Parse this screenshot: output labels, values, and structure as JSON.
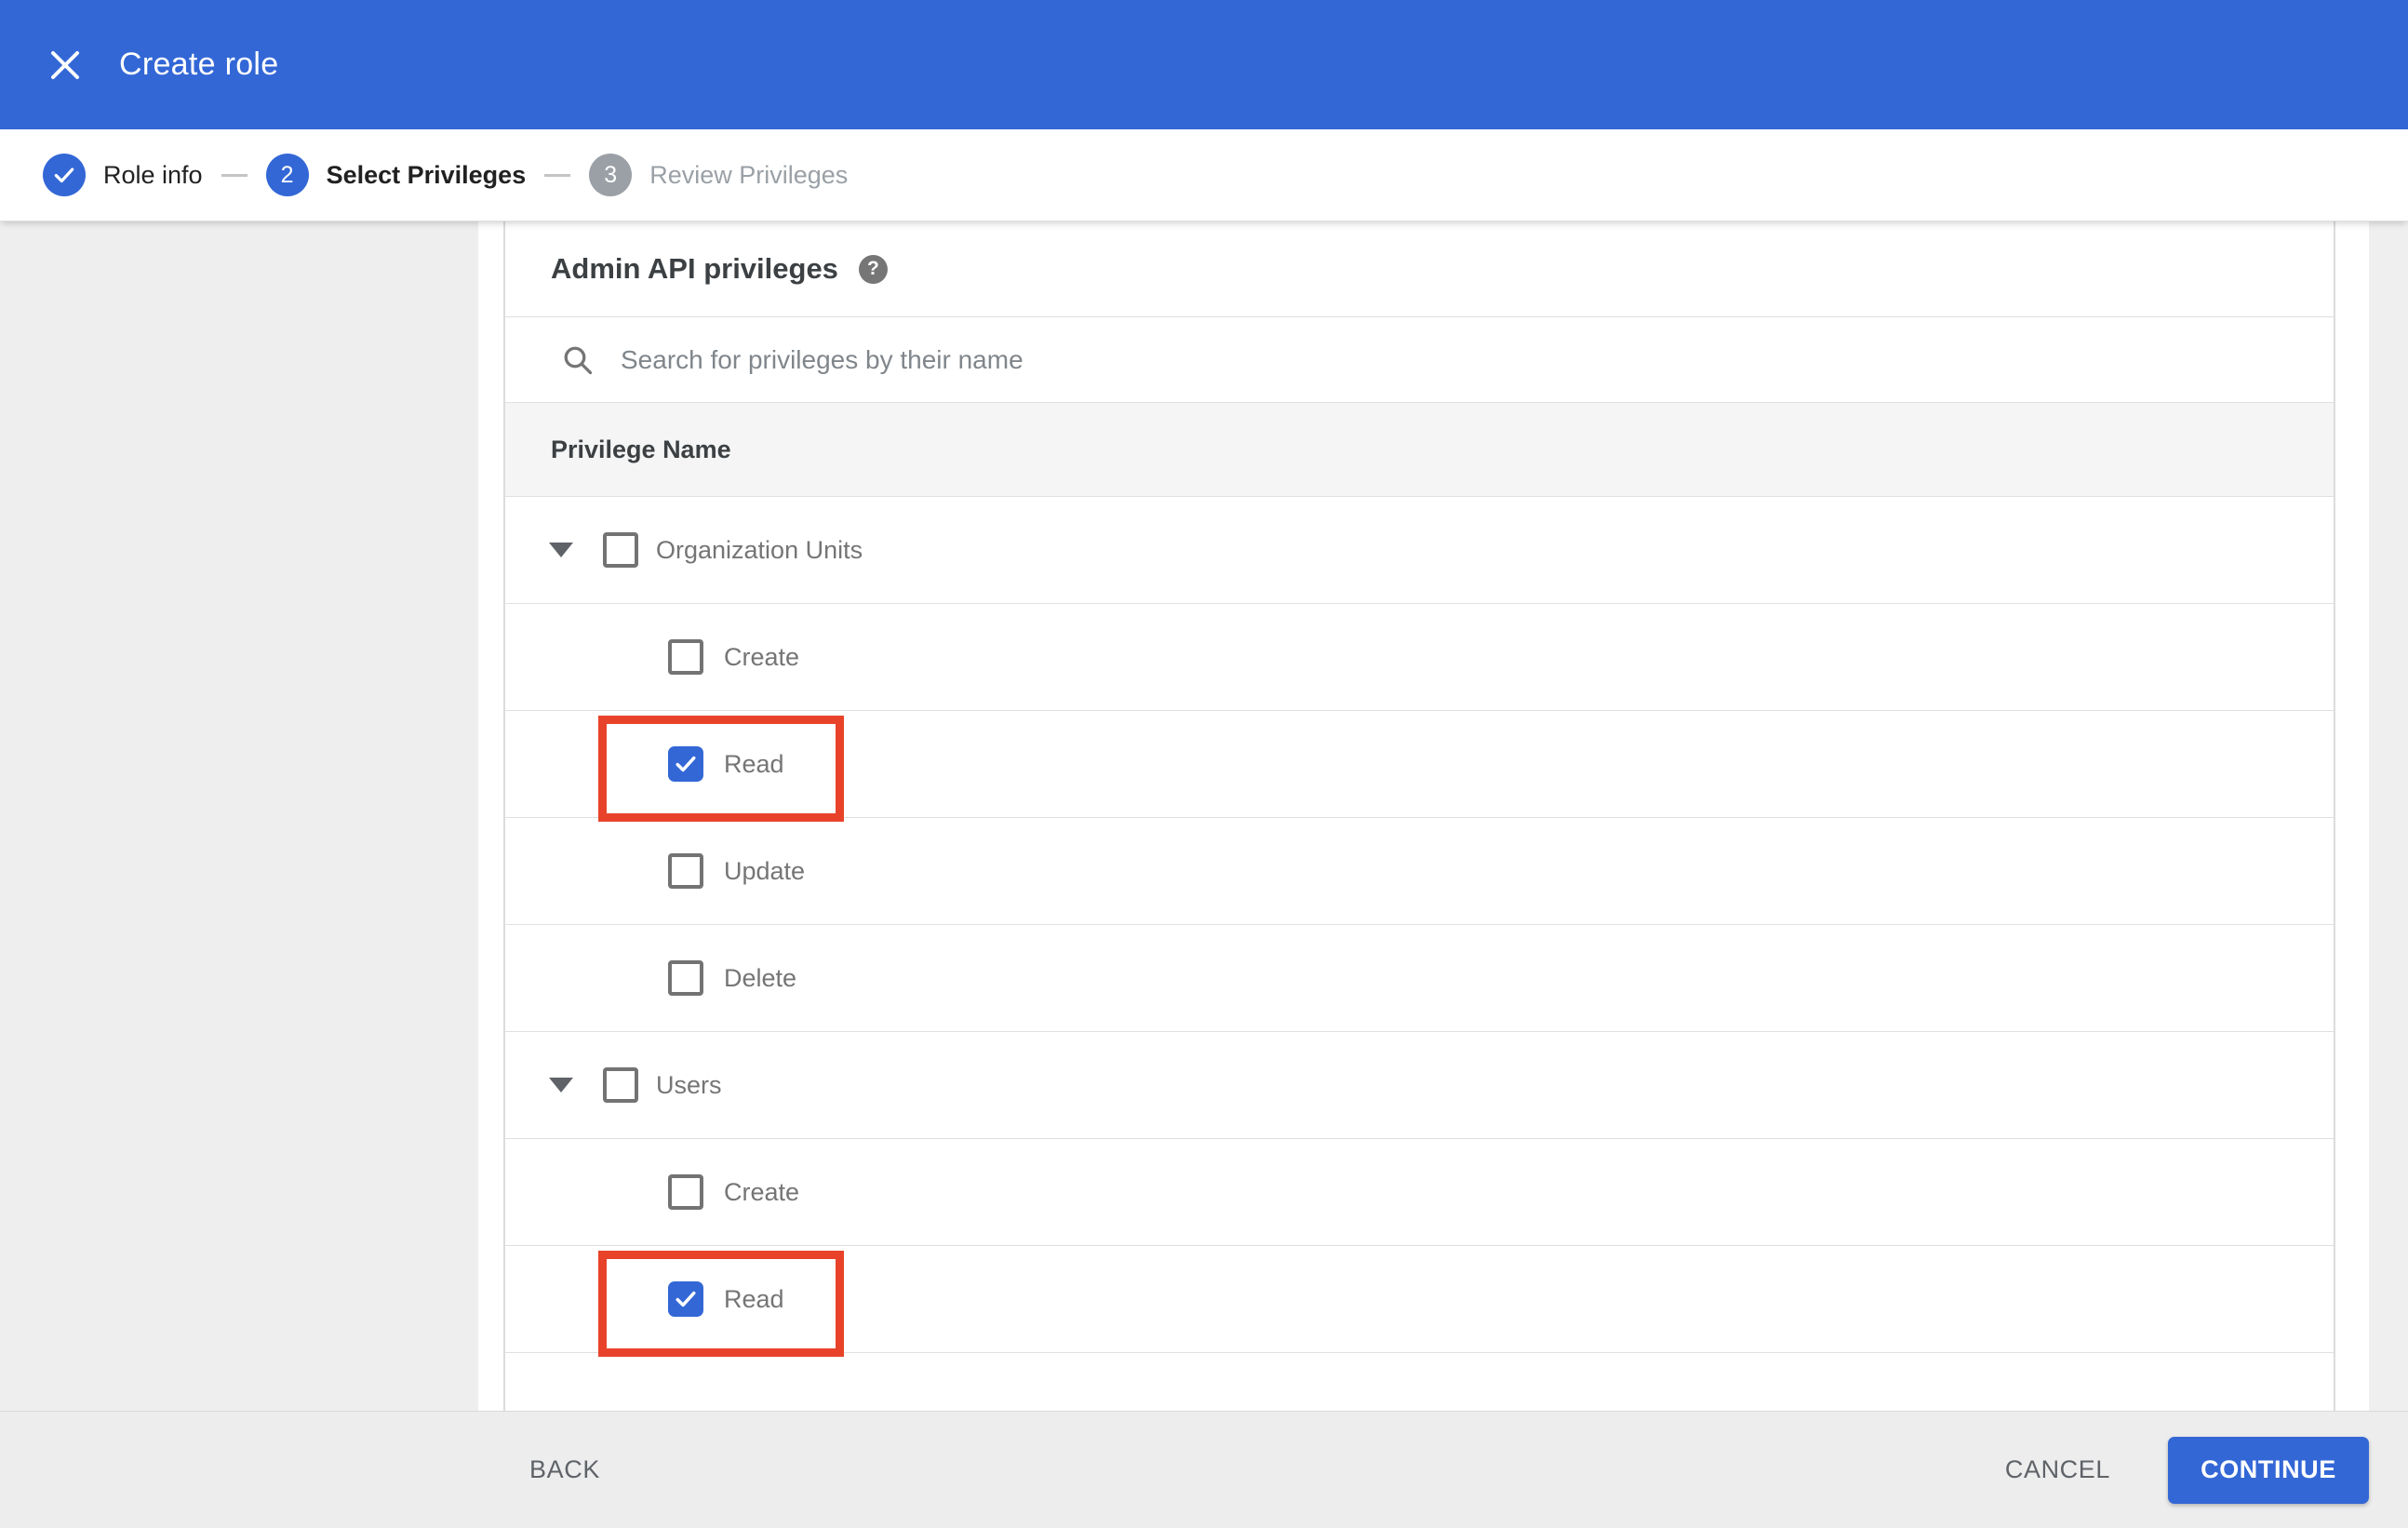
{
  "header": {
    "title": "Create role"
  },
  "stepper": {
    "steps": [
      {
        "num": "",
        "label": "Role info",
        "state": "done"
      },
      {
        "num": "2",
        "label": "Select Privileges",
        "state": "active"
      },
      {
        "num": "3",
        "label": "Review Privileges",
        "state": "upcoming"
      }
    ]
  },
  "content": {
    "heading": "Admin API privileges",
    "help_glyph": "?",
    "search_placeholder": "Search for privileges by their name",
    "table_header": "Privilege Name",
    "groups": [
      {
        "label": "Organization Units",
        "checked": false,
        "children": [
          {
            "label": "Create",
            "checked": false,
            "highlight": false
          },
          {
            "label": "Read",
            "checked": true,
            "highlight": true
          },
          {
            "label": "Update",
            "checked": false,
            "highlight": false
          },
          {
            "label": "Delete",
            "checked": false,
            "highlight": false
          }
        ]
      },
      {
        "label": "Users",
        "checked": false,
        "children": [
          {
            "label": "Create",
            "checked": false,
            "highlight": false
          },
          {
            "label": "Read",
            "checked": true,
            "highlight": true
          }
        ]
      }
    ]
  },
  "footer": {
    "back": "BACK",
    "cancel": "CANCEL",
    "continue": "CONTINUE"
  },
  "colors": {
    "accent_blue": "#3367d6",
    "highlight_red": "#e8432a",
    "inactive_step_gray": "#9aa0a6"
  }
}
